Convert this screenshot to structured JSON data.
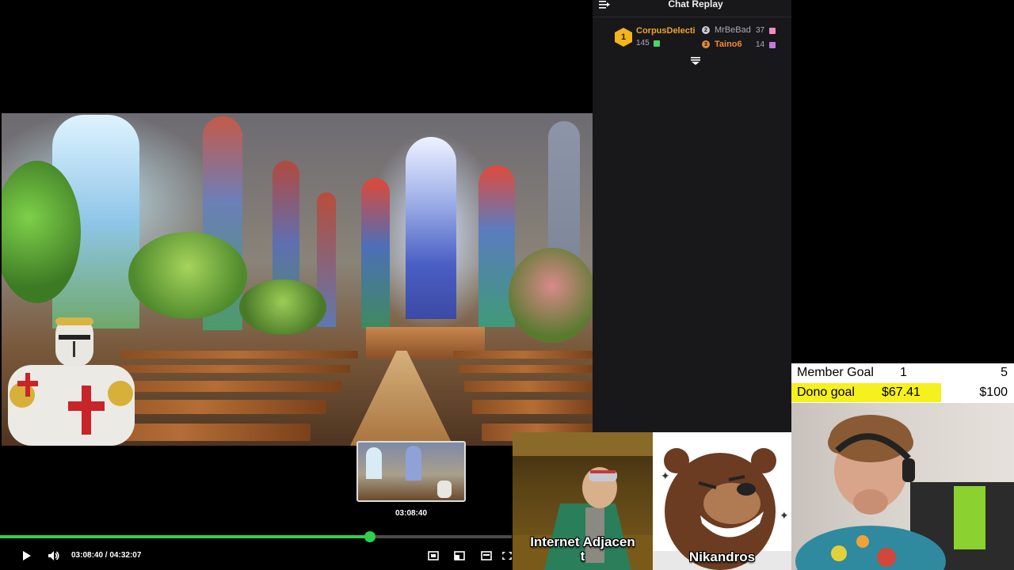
{
  "player": {
    "hover_time": "03:08:40",
    "time_display": "03:08:40 / 04:32:07",
    "progress_fraction": 0.7231,
    "icons": {
      "play": "play-icon",
      "volume": "volume-icon",
      "theater": "theater-mode-icon",
      "miniplayer": "miniplayer-icon",
      "clip": "clip-icon",
      "fullscreen": "fullscreen-icon"
    },
    "accent": "#2fd14b"
  },
  "chat": {
    "title": "Chat Replay",
    "leaderboard": {
      "first": {
        "rank": "1",
        "name": "CorpusDelecti",
        "count": "145",
        "name_color": "#f0a22e"
      },
      "second": {
        "name": "MrBeBad",
        "count": "37",
        "name_color": "#a9a9b3"
      },
      "third": {
        "name": "Taino6",
        "count": "14",
        "name_color": "#f08a2e"
      }
    }
  },
  "goals": {
    "member_label": "Member Goal",
    "member_current": "1",
    "member_target": "5",
    "dono_label": "Dono goal",
    "dono_current": "$67.41",
    "dono_target": "$100",
    "dono_fraction": 0.6741,
    "dono_color": "#f6f01e"
  },
  "characters": {
    "left_name": "Internet Adjacen\nt",
    "right_name": "Nikandros"
  }
}
